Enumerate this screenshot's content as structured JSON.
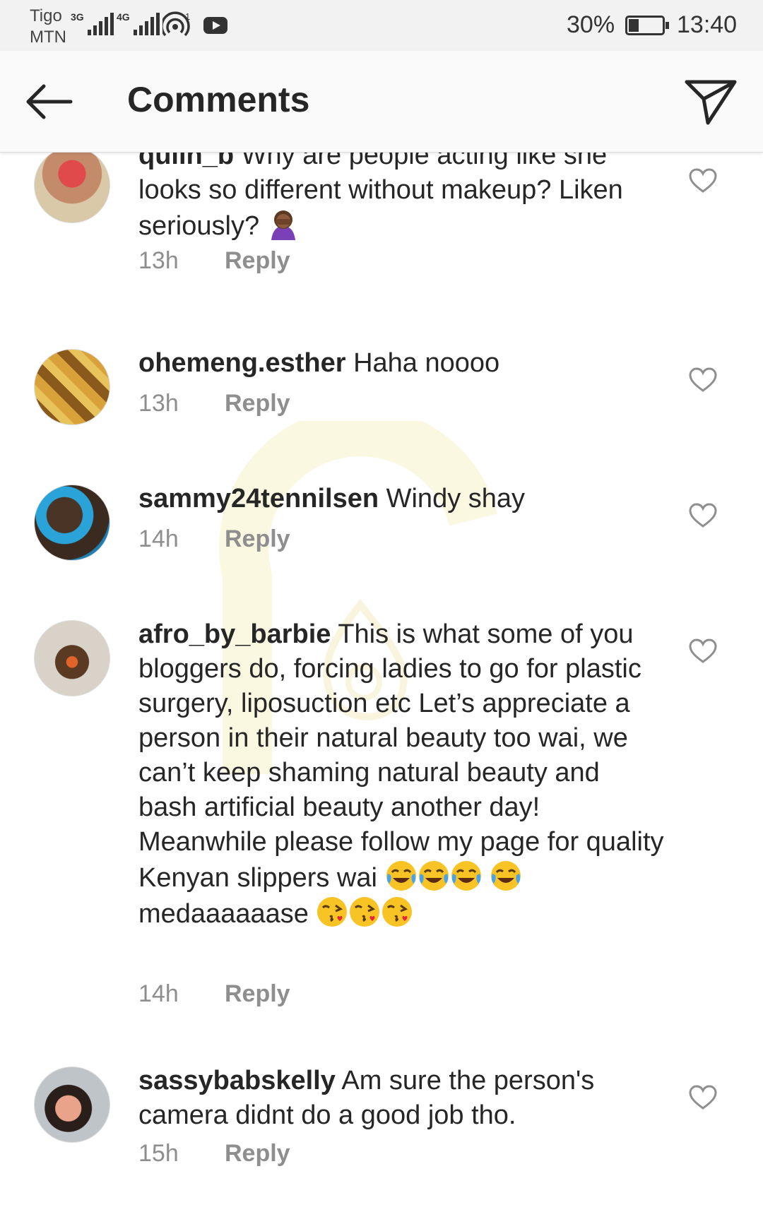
{
  "status_bar": {
    "carrier_top": "Tigo",
    "carrier_bottom": "MTN",
    "sim1_tag": "3G",
    "sim2_tag": "4G",
    "hotspot_count": "1",
    "battery_percent": "30%",
    "battery_level": 0.3,
    "time": "13:40"
  },
  "app_bar": {
    "title": "Comments",
    "back_icon": "arrow-left-icon",
    "send_icon": "paper-plane-icon"
  },
  "colors": {
    "text": "#262626",
    "secondary": "#8e8e8e",
    "appbar_bg": "#fafafa",
    "status_bg": "#f2f2f2"
  },
  "comments": [
    {
      "username": "quiin_b",
      "text": "Why are people acting like she looks so different without makeup? Liken seriously?",
      "emoji": "woman-facepalming",
      "time": "13h",
      "reply": "Reply"
    },
    {
      "username": "ohemeng.esther",
      "text": "Haha noooo",
      "time": "13h",
      "reply": "Reply"
    },
    {
      "username": "sammy24tennilsen",
      "text": "Windy shay",
      "time": "14h",
      "reply": "Reply"
    },
    {
      "username": "afro_by_barbie",
      "text": "This is what some of you bloggers do, forcing ladies to go for plastic surgery, liposuction etc Let’s appreciate a person in their natural beauty too wai, we can’t keep shaming natural beauty and bash artificial beauty another day! Meanwhile please follow my page for quality Kenyan slippers wai",
      "text_after": "medaaaaaase",
      "time": "14h",
      "reply": "Reply"
    },
    {
      "username": "sassybabskelly",
      "text": "Am sure the person's camera didnt do a good job tho.",
      "time": "15h",
      "reply": "Reply"
    }
  ]
}
